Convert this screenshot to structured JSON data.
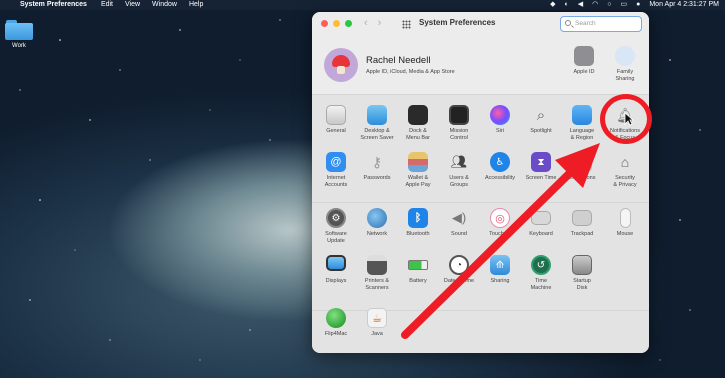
{
  "menubar": {
    "app_name": "System Preferences",
    "items": [
      "Edit",
      "View",
      "Window",
      "Help"
    ],
    "clock": "Mon Apr 4  2:31:27 PM"
  },
  "desktop": {
    "folder_label": "Work"
  },
  "window": {
    "title": "System Preferences",
    "search_placeholder": "Search"
  },
  "account": {
    "name": "Rachel Needell",
    "subtitle": "Apple ID, iCloud, Media & App Store",
    "apple_id_label": "Apple ID",
    "family_label": "Family\nSharing"
  },
  "row1": [
    {
      "label": "General",
      "icon": "general-icon"
    },
    {
      "label": "Desktop &\nScreen Saver",
      "icon": "desktop-icon"
    },
    {
      "label": "Dock &\nMenu Bar",
      "icon": "dock-icon"
    },
    {
      "label": "Mission\nControl",
      "icon": "mission-control-icon"
    },
    {
      "label": "Siri",
      "icon": "siri-icon"
    },
    {
      "label": "Spotlight",
      "icon": "spotlight-icon"
    },
    {
      "label": "Language\n& Region",
      "icon": "language-icon"
    },
    {
      "label": "Notifications\n& Focus",
      "icon": "notifications-icon"
    }
  ],
  "row2": [
    {
      "label": "Internet\nAccounts",
      "icon": "internet-accounts-icon"
    },
    {
      "label": "Passwords",
      "icon": "passwords-icon"
    },
    {
      "label": "Wallet &\nApple Pay",
      "icon": "wallet-icon"
    },
    {
      "label": "Users &\nGroups",
      "icon": "users-icon"
    },
    {
      "label": "Accessibility",
      "icon": "accessibility-icon"
    },
    {
      "label": "Screen Time",
      "icon": "screen-time-icon"
    },
    {
      "label": "Extensions",
      "icon": "extensions-icon"
    },
    {
      "label": "Security\n& Privacy",
      "icon": "security-icon"
    }
  ],
  "row3": [
    {
      "label": "Software\nUpdate",
      "icon": "software-update-icon"
    },
    {
      "label": "Network",
      "icon": "network-icon"
    },
    {
      "label": "Bluetooth",
      "icon": "bluetooth-icon"
    },
    {
      "label": "Sound",
      "icon": "sound-icon"
    },
    {
      "label": "Touch ID",
      "icon": "touch-id-icon"
    },
    {
      "label": "Keyboard",
      "icon": "keyboard-icon"
    },
    {
      "label": "Trackpad",
      "icon": "trackpad-icon"
    },
    {
      "label": "Mouse",
      "icon": "mouse-icon"
    }
  ],
  "row4": [
    {
      "label": "Displays",
      "icon": "displays-icon"
    },
    {
      "label": "Printers &\nScanners",
      "icon": "printers-icon"
    },
    {
      "label": "Battery",
      "icon": "battery-icon"
    },
    {
      "label": "Date & Time",
      "icon": "date-time-icon"
    },
    {
      "label": "Sharing",
      "icon": "sharing-icon"
    },
    {
      "label": "Time\nMachine",
      "icon": "time-machine-icon"
    },
    {
      "label": "Startup\nDisk",
      "icon": "startup-disk-icon"
    }
  ],
  "row5": [
    {
      "label": "Flip4Mac",
      "icon": "flip4mac-icon"
    },
    {
      "label": "Java",
      "icon": "java-icon"
    }
  ],
  "colors": {
    "annotation_red": "#ee1c25",
    "accent_blue": "#7aa9e6"
  }
}
